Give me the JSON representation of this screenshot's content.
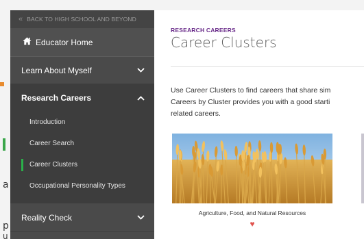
{
  "sidebar": {
    "back_label": "BACK TO HIGH SCHOOL AND BEYOND",
    "home_label": "Educator Home",
    "sections": [
      {
        "label": "Learn About Myself",
        "expanded": false
      },
      {
        "label": "Research Careers",
        "expanded": true
      },
      {
        "label": "Reality Check",
        "expanded": false
      }
    ],
    "research_items": [
      {
        "label": "Introduction",
        "active": false
      },
      {
        "label": "Career Search",
        "active": false
      },
      {
        "label": "Career Clusters",
        "active": true
      },
      {
        "label": "Occupational Personality Types",
        "active": false
      }
    ]
  },
  "main": {
    "section_label": "RESEARCH CAREERS",
    "title": "Career Clusters",
    "intro_lines": [
      "Use Career Clusters to find careers that share sim",
      "Careers by Cluster provides you with a good starti",
      "related careers."
    ],
    "cards": [
      {
        "caption": "Agriculture, Food, and Natural Resources",
        "icon": "heart-icon"
      }
    ]
  },
  "colors": {
    "sidebar_bg": "#4a4a4a",
    "active_bg": "#3d3d3d",
    "active_marker": "#2bb04a",
    "section_label": "#6a2c8a",
    "heart": "#e0524d"
  }
}
